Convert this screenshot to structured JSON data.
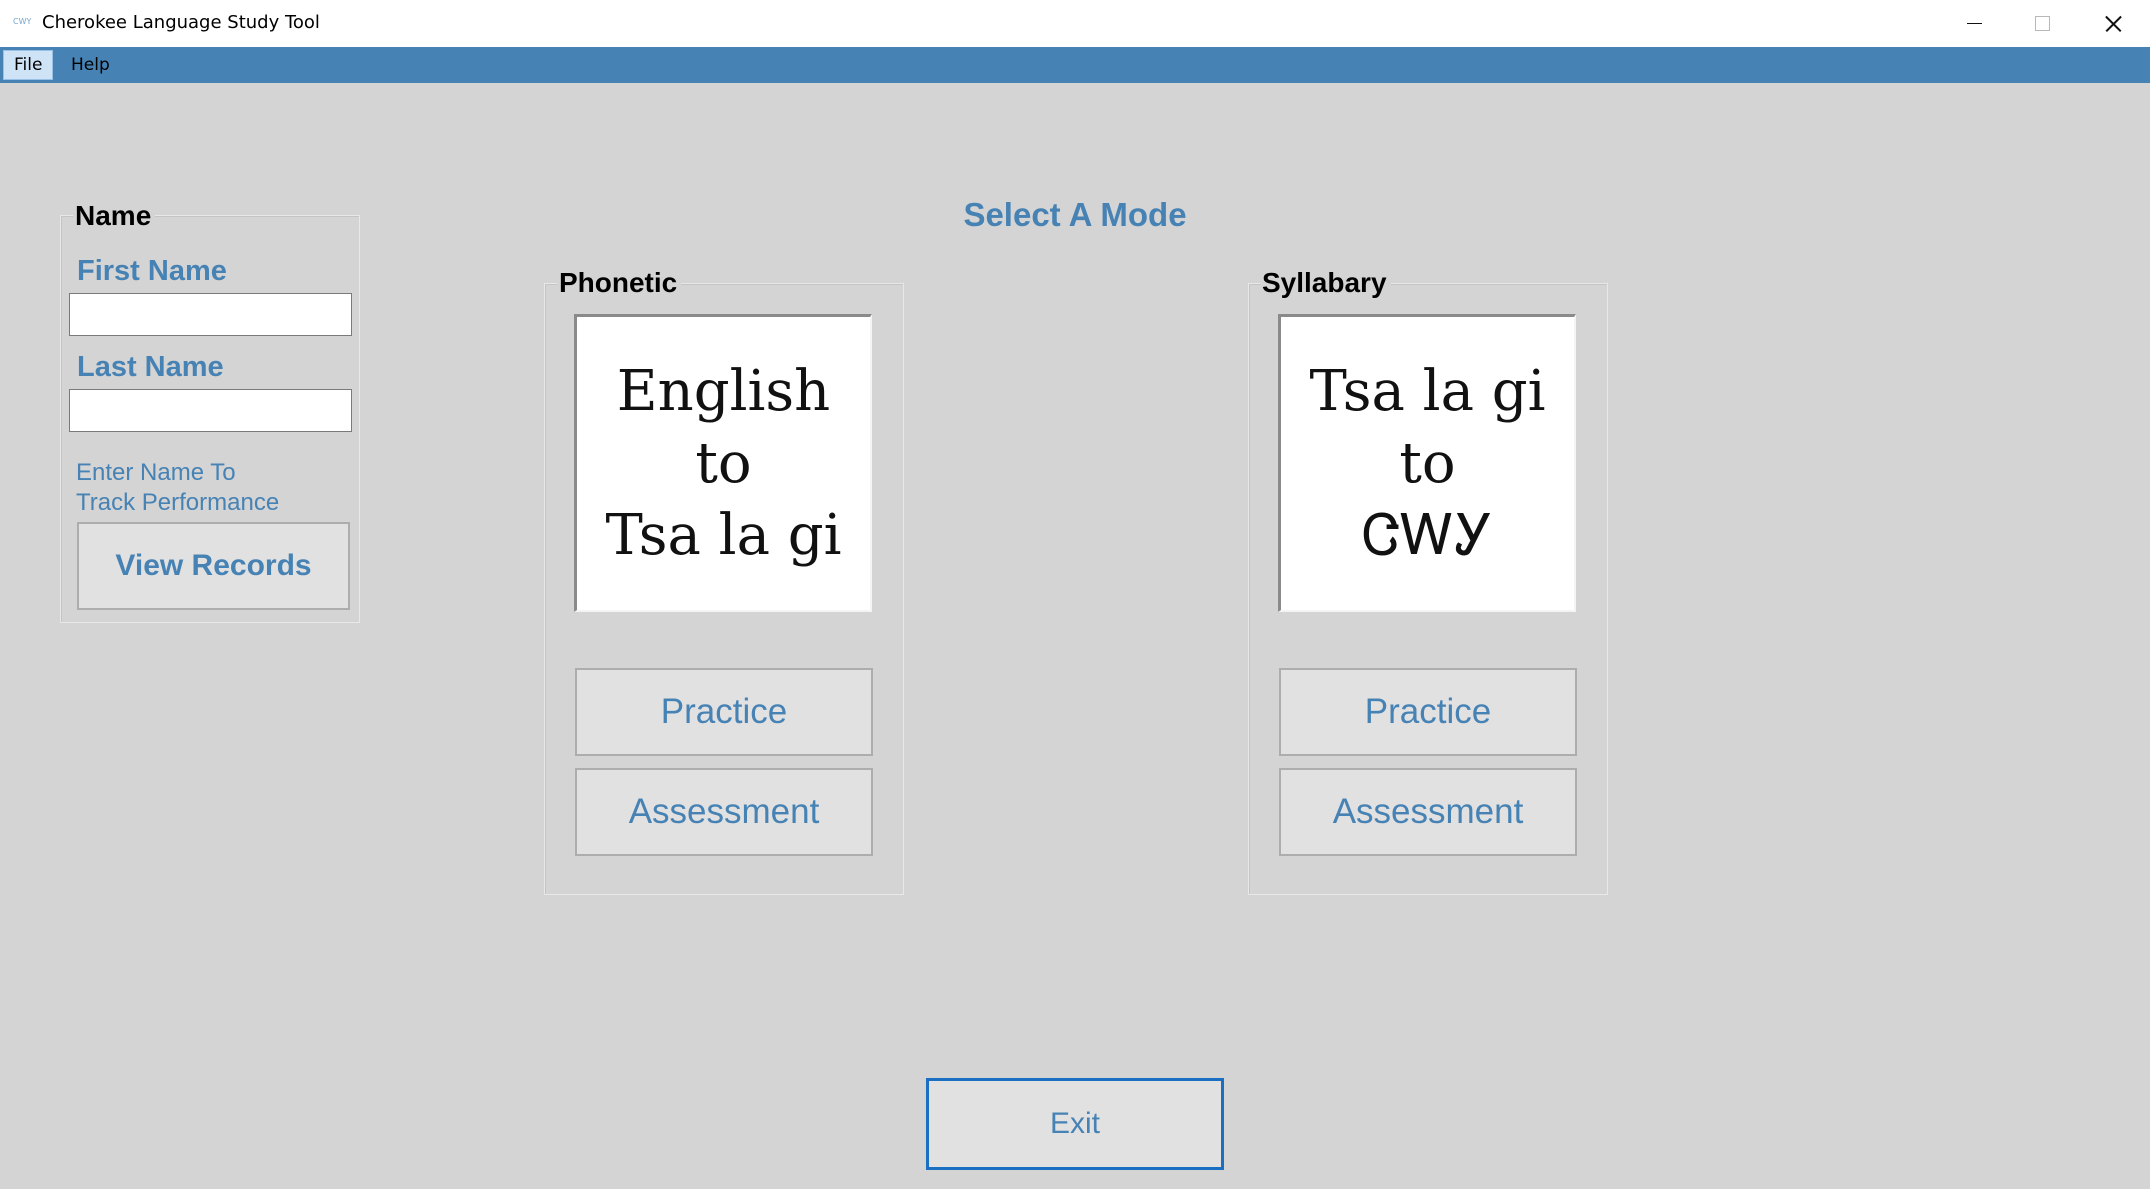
{
  "window": {
    "icon_text": "CWY",
    "title": "Cherokee Language Study Tool"
  },
  "menu": {
    "items": [
      {
        "label": "File"
      },
      {
        "label": "Help"
      }
    ]
  },
  "name_panel": {
    "title": "Name",
    "first_name_label": "First Name",
    "first_name_value": "",
    "last_name_label": "Last Name",
    "last_name_value": "",
    "hint_line1": "Enter Name To",
    "hint_line2": "Track Performance",
    "view_records_label": "View Records"
  },
  "mode_heading": "Select A Mode",
  "phonetic": {
    "title": "Phonetic",
    "card_lines": [
      "English",
      "to",
      "Tsa la gi"
    ],
    "practice_label": "Practice",
    "assessment_label": "Assessment"
  },
  "syllabary": {
    "title": "Syllabary",
    "card_lines": [
      "Tsa la gi",
      "to",
      "ᏣᎳᎩ"
    ],
    "practice_label": "Practice",
    "assessment_label": "Assessment"
  },
  "exit_label": "Exit",
  "colors": {
    "accent": "#4682b4",
    "background": "#d4d4d4",
    "exit_border": "#1a6fc2"
  }
}
